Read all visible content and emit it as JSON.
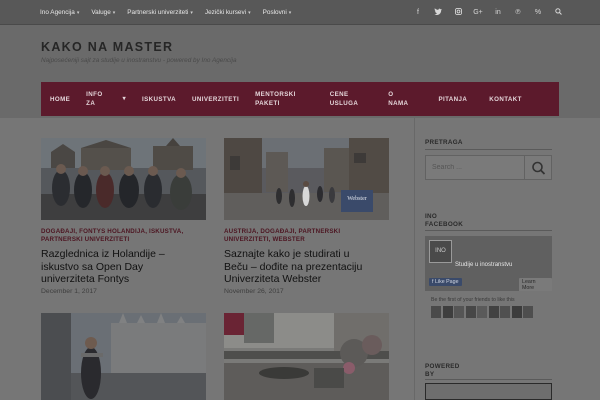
{
  "topbar": {
    "items": [
      {
        "label": "Ino Agencija",
        "dropdown": true
      },
      {
        "label": "Valuge",
        "dropdown": true
      },
      {
        "label": "Partnerski univerziteti",
        "dropdown": true
      },
      {
        "label": "Jezički kursevi",
        "dropdown": true
      },
      {
        "label": "Poslovni",
        "dropdown": true
      }
    ],
    "social_icons": [
      "facebook-icon",
      "twitter-icon",
      "instagram-icon",
      "google-plus-icon",
      "linkedin-icon",
      "pinterest-icon",
      "link-icon",
      "search-icon"
    ]
  },
  "header": {
    "title": "KAKO NA MASTER",
    "tagline": "Najposećeniji sajt za studije u inostranstvu - powered by Ino Agencija"
  },
  "mainnav": {
    "items": [
      {
        "label": "HOME"
      },
      {
        "label": "INFO\nZA",
        "dropdown": true
      },
      {
        "label": "ISKUSTVA"
      },
      {
        "label": "UNIVERZITETI"
      },
      {
        "label": "MENTORSKI\nPAKETI"
      },
      {
        "label": "CENE\nUSLUGA"
      },
      {
        "label": "O\nNAMA"
      },
      {
        "label": "PITANJA"
      },
      {
        "label": "KONTAKT"
      }
    ]
  },
  "posts": [
    {
      "categories": "DOGAĐAJI, FONTYS HOLANDIJA, ISKUSTVA,\nPARTNERSKI UNIVERZITETI",
      "title": "Razglednica iz Holandije –\niskustvo sa Open Day\nuniverziteta Fontys",
      "date": "December 1, 2017"
    },
    {
      "categories": "AUSTRIJA, DOGAĐAJI, PARTNERSKI\nUNIVERZITETI, WEBSTER",
      "title": "Saznajte kako je studirati u\nBeču – dođite na prezentaciju\nUniverziteta Webster",
      "date": "November 26, 2017",
      "image_sign": "Webster"
    }
  ],
  "sidebar": {
    "search": {
      "title": "PRETRAGA",
      "placeholder": "Search ..."
    },
    "facebook": {
      "title": "INO\nFACEBOOK",
      "page_name": "Studije u inostranstvu",
      "logo_text": "INO",
      "like_label": "Like Page",
      "learn_label": "Learn More",
      "friends_text": "Be the first of your friends to like this"
    },
    "powered": {
      "title": "POWERED\nBY"
    }
  },
  "colors": {
    "nav_bg": "#5c1a2c",
    "category_text": "#4d1622"
  }
}
